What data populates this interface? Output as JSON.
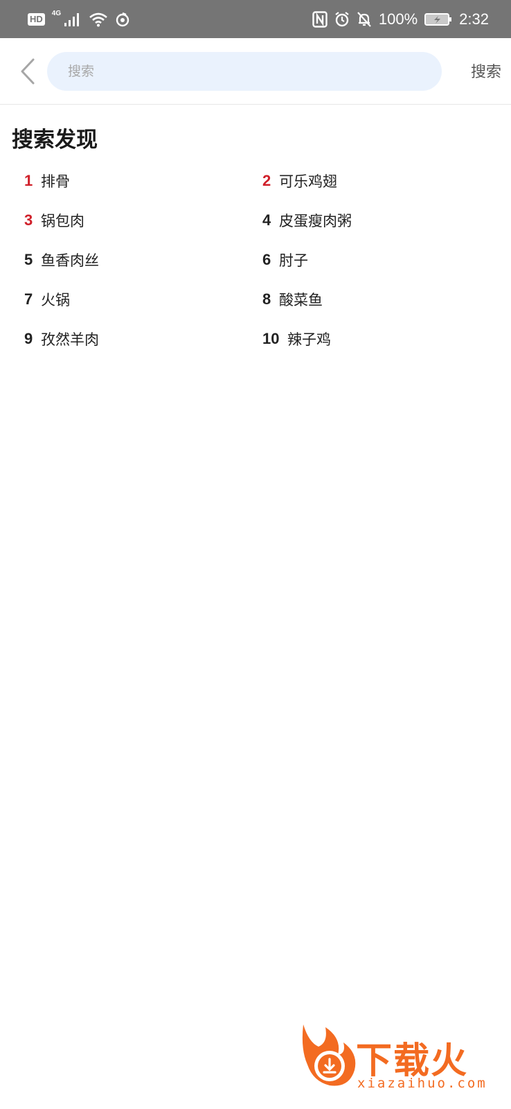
{
  "status_bar": {
    "hd_label": "HD",
    "network": "4G",
    "battery": "100%",
    "time": "2:32",
    "icons": [
      "signal-icon",
      "wifi-icon",
      "hotspot-icon",
      "nfc-icon",
      "alarm-icon",
      "mute-icon",
      "battery-icon"
    ]
  },
  "search": {
    "placeholder": "搜索",
    "value": "",
    "submit_label": "搜索"
  },
  "discover": {
    "title": "搜索发现",
    "items": [
      {
        "rank": "1",
        "term": "排骨",
        "highlight": true
      },
      {
        "rank": "2",
        "term": "可乐鸡翅",
        "highlight": true
      },
      {
        "rank": "3",
        "term": "锅包肉",
        "highlight": true
      },
      {
        "rank": "4",
        "term": "皮蛋瘦肉粥",
        "highlight": false
      },
      {
        "rank": "5",
        "term": "鱼香肉丝",
        "highlight": false
      },
      {
        "rank": "6",
        "term": "肘子",
        "highlight": false
      },
      {
        "rank": "7",
        "term": "火锅",
        "highlight": false
      },
      {
        "rank": "8",
        "term": "酸菜鱼",
        "highlight": false
      },
      {
        "rank": "9",
        "term": "孜然羊肉",
        "highlight": false
      },
      {
        "rank": "10",
        "term": "辣子鸡",
        "highlight": false
      }
    ],
    "highlight_color": "#d0202a"
  },
  "watermark": {
    "brand": "下载火",
    "url": "xiazaihuo.com",
    "color": "#f36b21"
  }
}
